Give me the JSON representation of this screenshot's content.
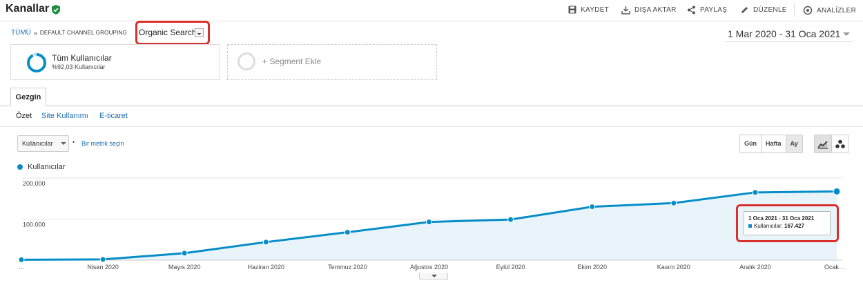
{
  "header": {
    "title": "Kanallar",
    "actions": [
      {
        "label": "KAYDET",
        "icon": "save-icon"
      },
      {
        "label": "DIŞA AKTAR",
        "icon": "export-icon"
      },
      {
        "label": "PAYLAŞ",
        "icon": "share-icon"
      },
      {
        "label": "DÜZENLE",
        "icon": "edit-icon"
      },
      {
        "label": "ANALİZLER",
        "icon": "insights-icon"
      }
    ]
  },
  "breadcrumb": {
    "root": "TÜMÜ",
    "separator": "»",
    "group": "DEFAULT CHANNEL GROUPING",
    "selected": "Organic Search"
  },
  "date_range": "1 Mar 2020 - 31 Oca 2021",
  "segments": {
    "active_title": "Tüm Kullanıcılar",
    "active_sub": "%92,03 Kullanıcılar",
    "add_label": "+ Segment Ekle"
  },
  "tabs": {
    "active": "Gezgin"
  },
  "subnav": [
    "Özet",
    "Site Kullanımı",
    "E-ticaret"
  ],
  "metric": {
    "selected": "Kullanıcılar",
    "bullet": "•",
    "pick_other": "Bir metrik seçin"
  },
  "view_buttons": [
    "Gün",
    "Hafta",
    "Ay"
  ],
  "legend": "Kullanıcılar",
  "colors": {
    "series": "#058dc7",
    "highlight": "#d9302c",
    "link": "#1a6fb3"
  },
  "tooltip": {
    "title": "1 Oca 2021 - 31 Oca 2021",
    "label": "Kullanıcılar:",
    "value": "167.427"
  },
  "chart_data": {
    "type": "area",
    "x": [
      "…",
      "Nisan 2020",
      "Mayıs 2020",
      "Haziran 2020",
      "Temmuz 2020",
      "Ağustos 2020",
      "Eylül 2020",
      "Ekim 2020",
      "Kasım 2020",
      "Aralık 2020",
      "Ocak…"
    ],
    "yticks": [
      "200.000",
      "100.000"
    ],
    "ylim": [
      0,
      200000
    ],
    "grid": true,
    "series": [
      {
        "name": "Kullanıcılar",
        "values": [
          1000,
          1800,
          17000,
          44000,
          68000,
          93000,
          99000,
          130000,
          139000,
          165000,
          167427
        ]
      }
    ]
  }
}
